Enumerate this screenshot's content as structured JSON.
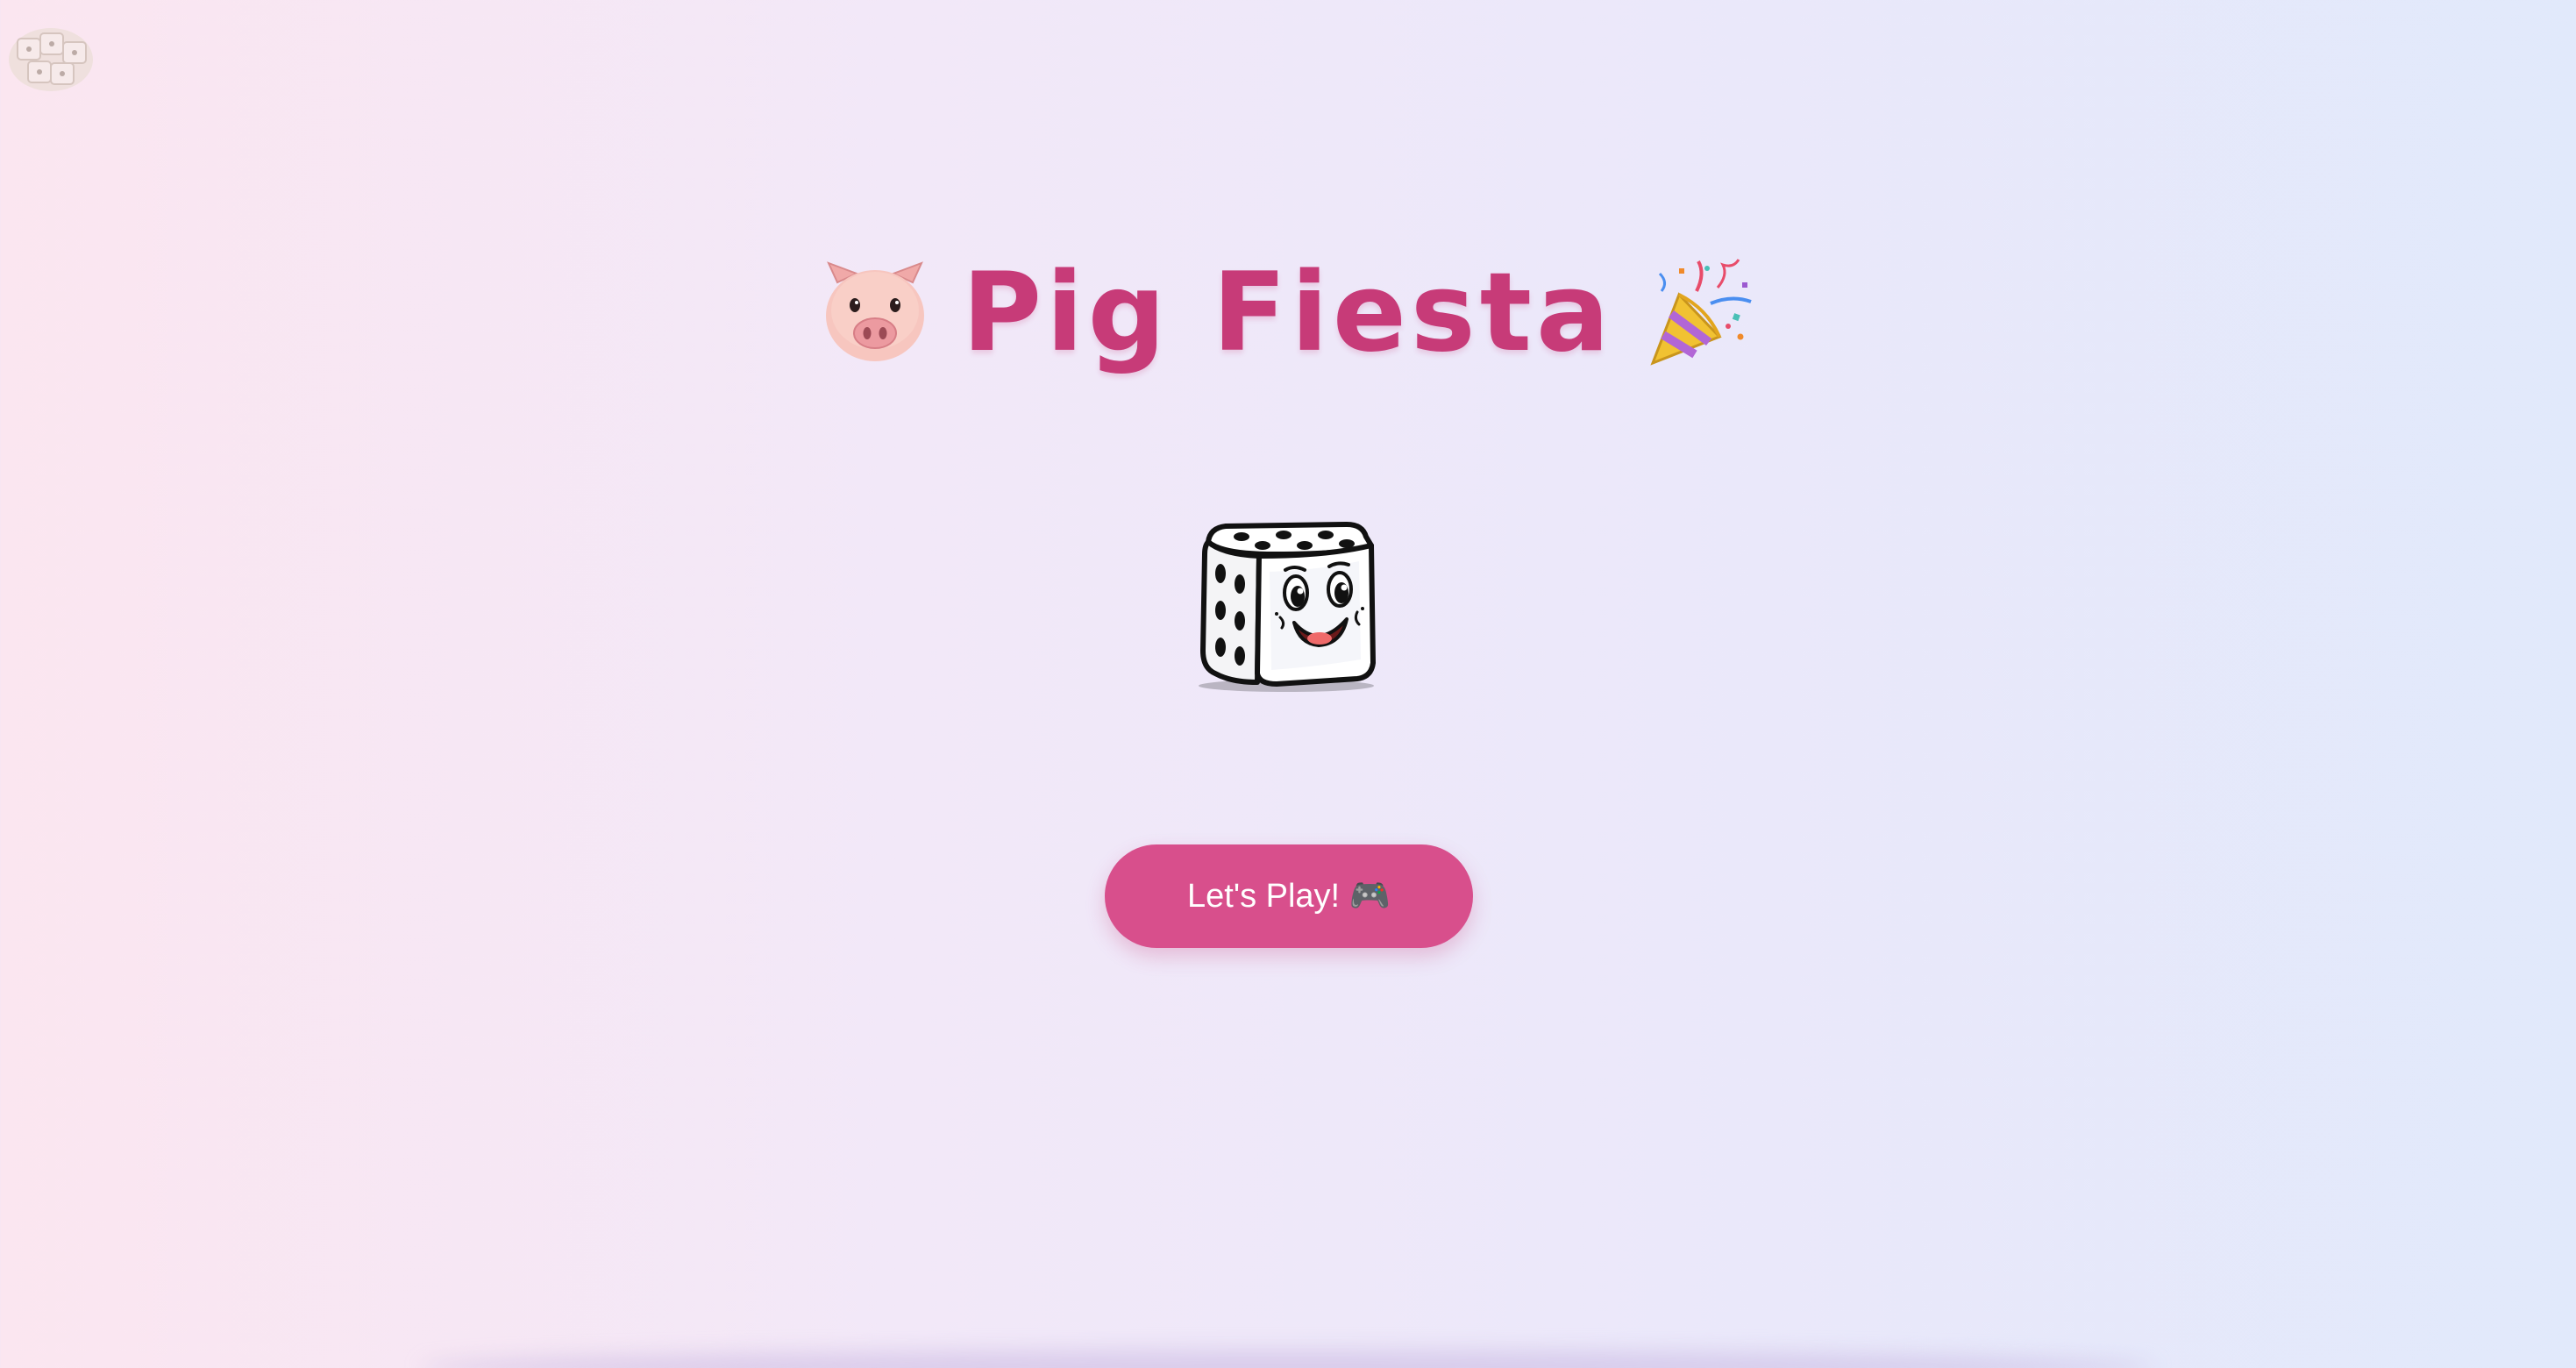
{
  "header": {
    "title": "Pig Fiesta",
    "leading_icon": "pig-face-icon",
    "trailing_icon": "party-popper-icon"
  },
  "mascot": {
    "icon": "smiling-dice-icon"
  },
  "actions": {
    "play_label": "Let's Play! 🎮",
    "play_icon": "gamepad-icon"
  },
  "colors": {
    "title": "#c73b78",
    "button": "#d84f8c",
    "button_text": "#ffffff"
  }
}
